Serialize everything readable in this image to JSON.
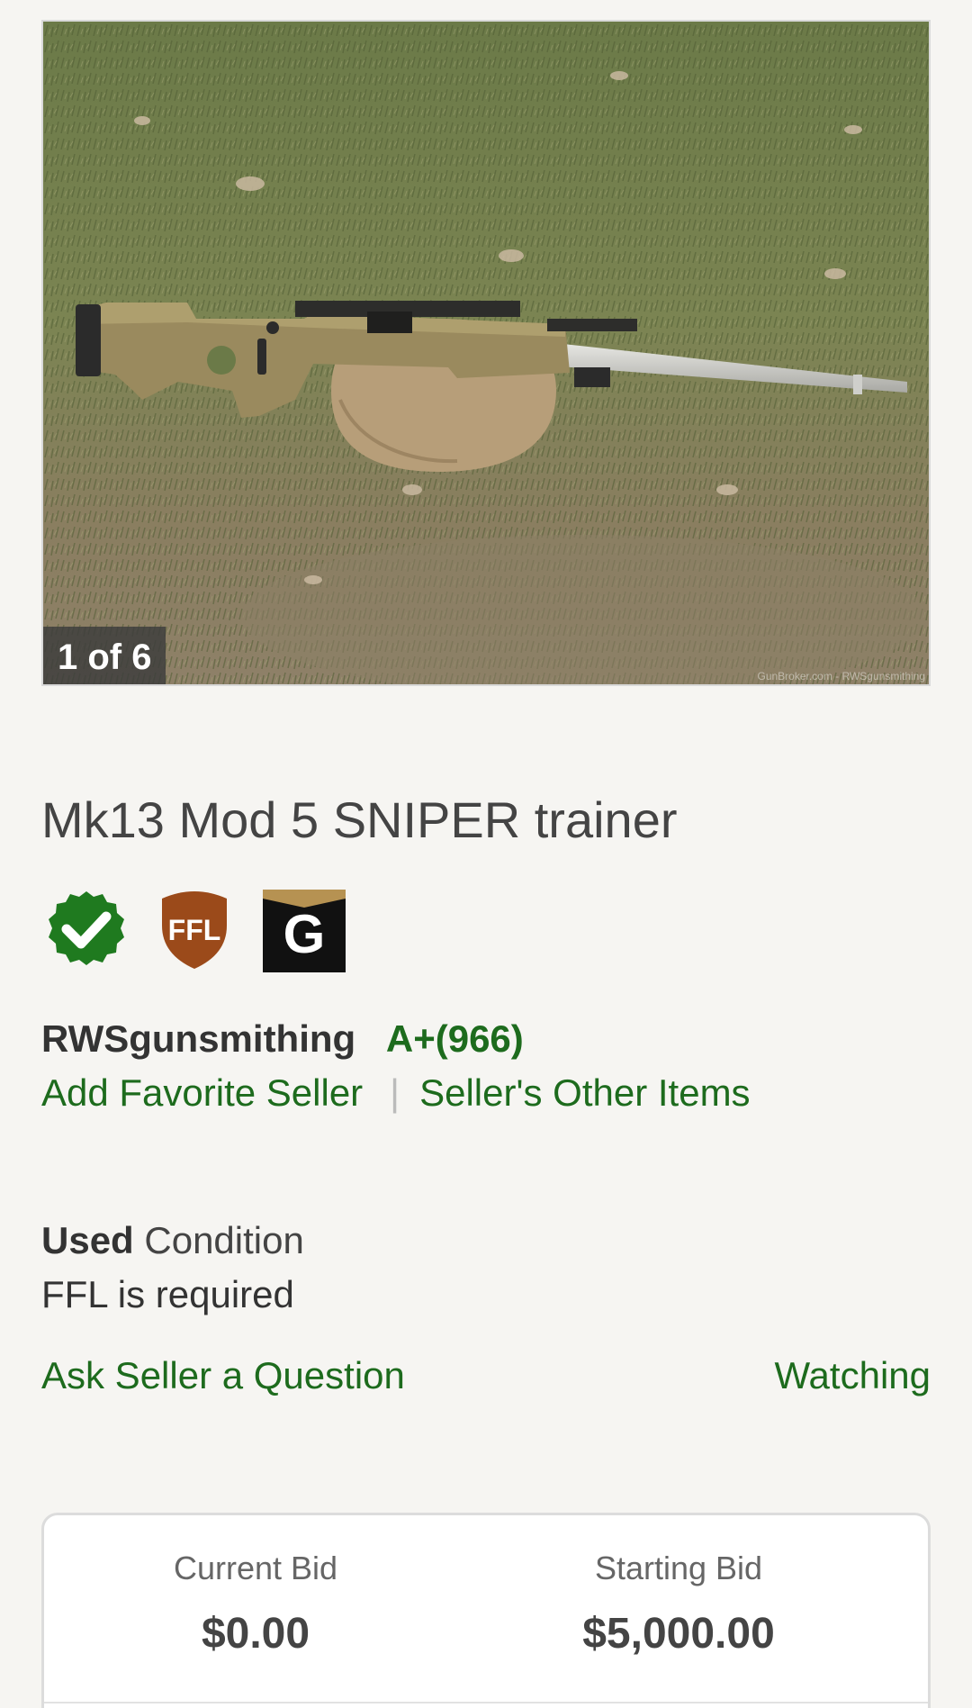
{
  "gallery": {
    "counter": "1 of 6",
    "watermark": "GunBroker.com - RWSgunsmithing"
  },
  "listing": {
    "title": "Mk13 Mod 5 SNIPER trainer",
    "badges": [
      {
        "icon": "verified-check-icon",
        "color": "#1f7a1f"
      },
      {
        "icon": "ffl-shield-icon",
        "text": "FFL",
        "color": "#9b4a1a"
      },
      {
        "icon": "gunbroker-g-icon",
        "text": "G",
        "color": "#111111"
      }
    ]
  },
  "seller": {
    "name": "RWSgunsmithing",
    "rating": "A+(966)",
    "add_favorite": "Add Favorite Seller",
    "other_items": "Seller's Other Items"
  },
  "details": {
    "condition_value": "Used",
    "condition_label": "Condition",
    "ffl_note": "FFL is required"
  },
  "actions": {
    "ask_question": "Ask Seller a Question",
    "watching": "Watching"
  },
  "bids": {
    "current_label": "Current Bid",
    "current_value": "$0.00",
    "starting_label": "Starting Bid",
    "starting_value": "$5,000.00"
  },
  "colors": {
    "link_green": "#1d6b1d",
    "background": "#f6f5f2"
  }
}
